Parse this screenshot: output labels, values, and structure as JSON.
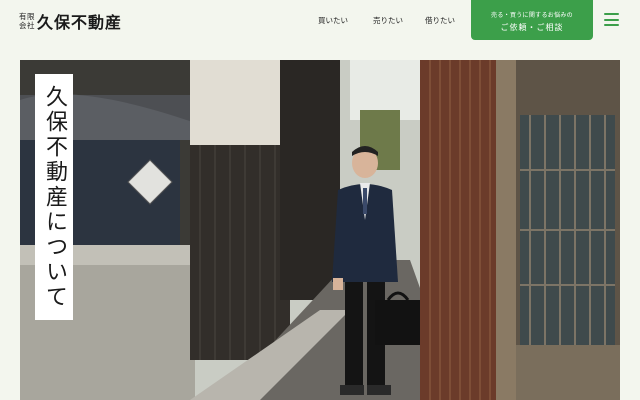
{
  "header": {
    "logo_small": "有限会社",
    "logo_main": "久保不動産",
    "nav": [
      "買いたい",
      "売りたい",
      "借りたい"
    ],
    "cta_sub": "売る・買うに関するお悩みの",
    "cta_main": "ご依頼・ご相談",
    "menu_icon": "hamburger-menu-icon"
  },
  "hero": {
    "title": "久保不動産について"
  },
  "colors": {
    "brand_green": "#3c9f4a",
    "background": "#f3f6ee"
  }
}
